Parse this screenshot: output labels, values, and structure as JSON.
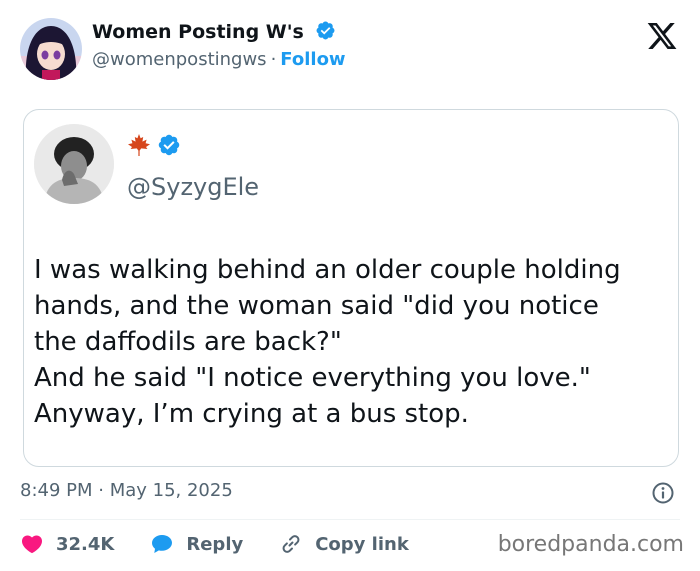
{
  "post": {
    "author_name": "Women Posting W's",
    "author_handle": "@womenpostingws",
    "separator": "·",
    "follow_label": "Follow",
    "timestamp": "8:49 PM · May 15, 2025",
    "likes": "32.4K",
    "reply_label": "Reply",
    "copy_link_label": "Copy link"
  },
  "quoted": {
    "handle": "@SyzygEle",
    "name_icon": "maple-leaf-emoji",
    "text_lines": [
      "I was walking behind an older couple holding",
      "hands, and the woman said \"did you notice",
      "the daffodils are back?\"",
      "And he said \"I notice everything you love.\"",
      "Anyway, I’m crying at a bus stop."
    ]
  },
  "watermark": "boredpanda.com",
  "colors": {
    "accent": "#1d9bf0",
    "like": "#f91880",
    "text_primary": "#0f1419",
    "text_secondary": "#536471",
    "border": "#cfd9de"
  },
  "icons": [
    "verified-badge-icon",
    "x-logo-icon",
    "maple-leaf-icon",
    "info-icon",
    "heart-icon",
    "reply-bubble-icon",
    "link-icon"
  ]
}
